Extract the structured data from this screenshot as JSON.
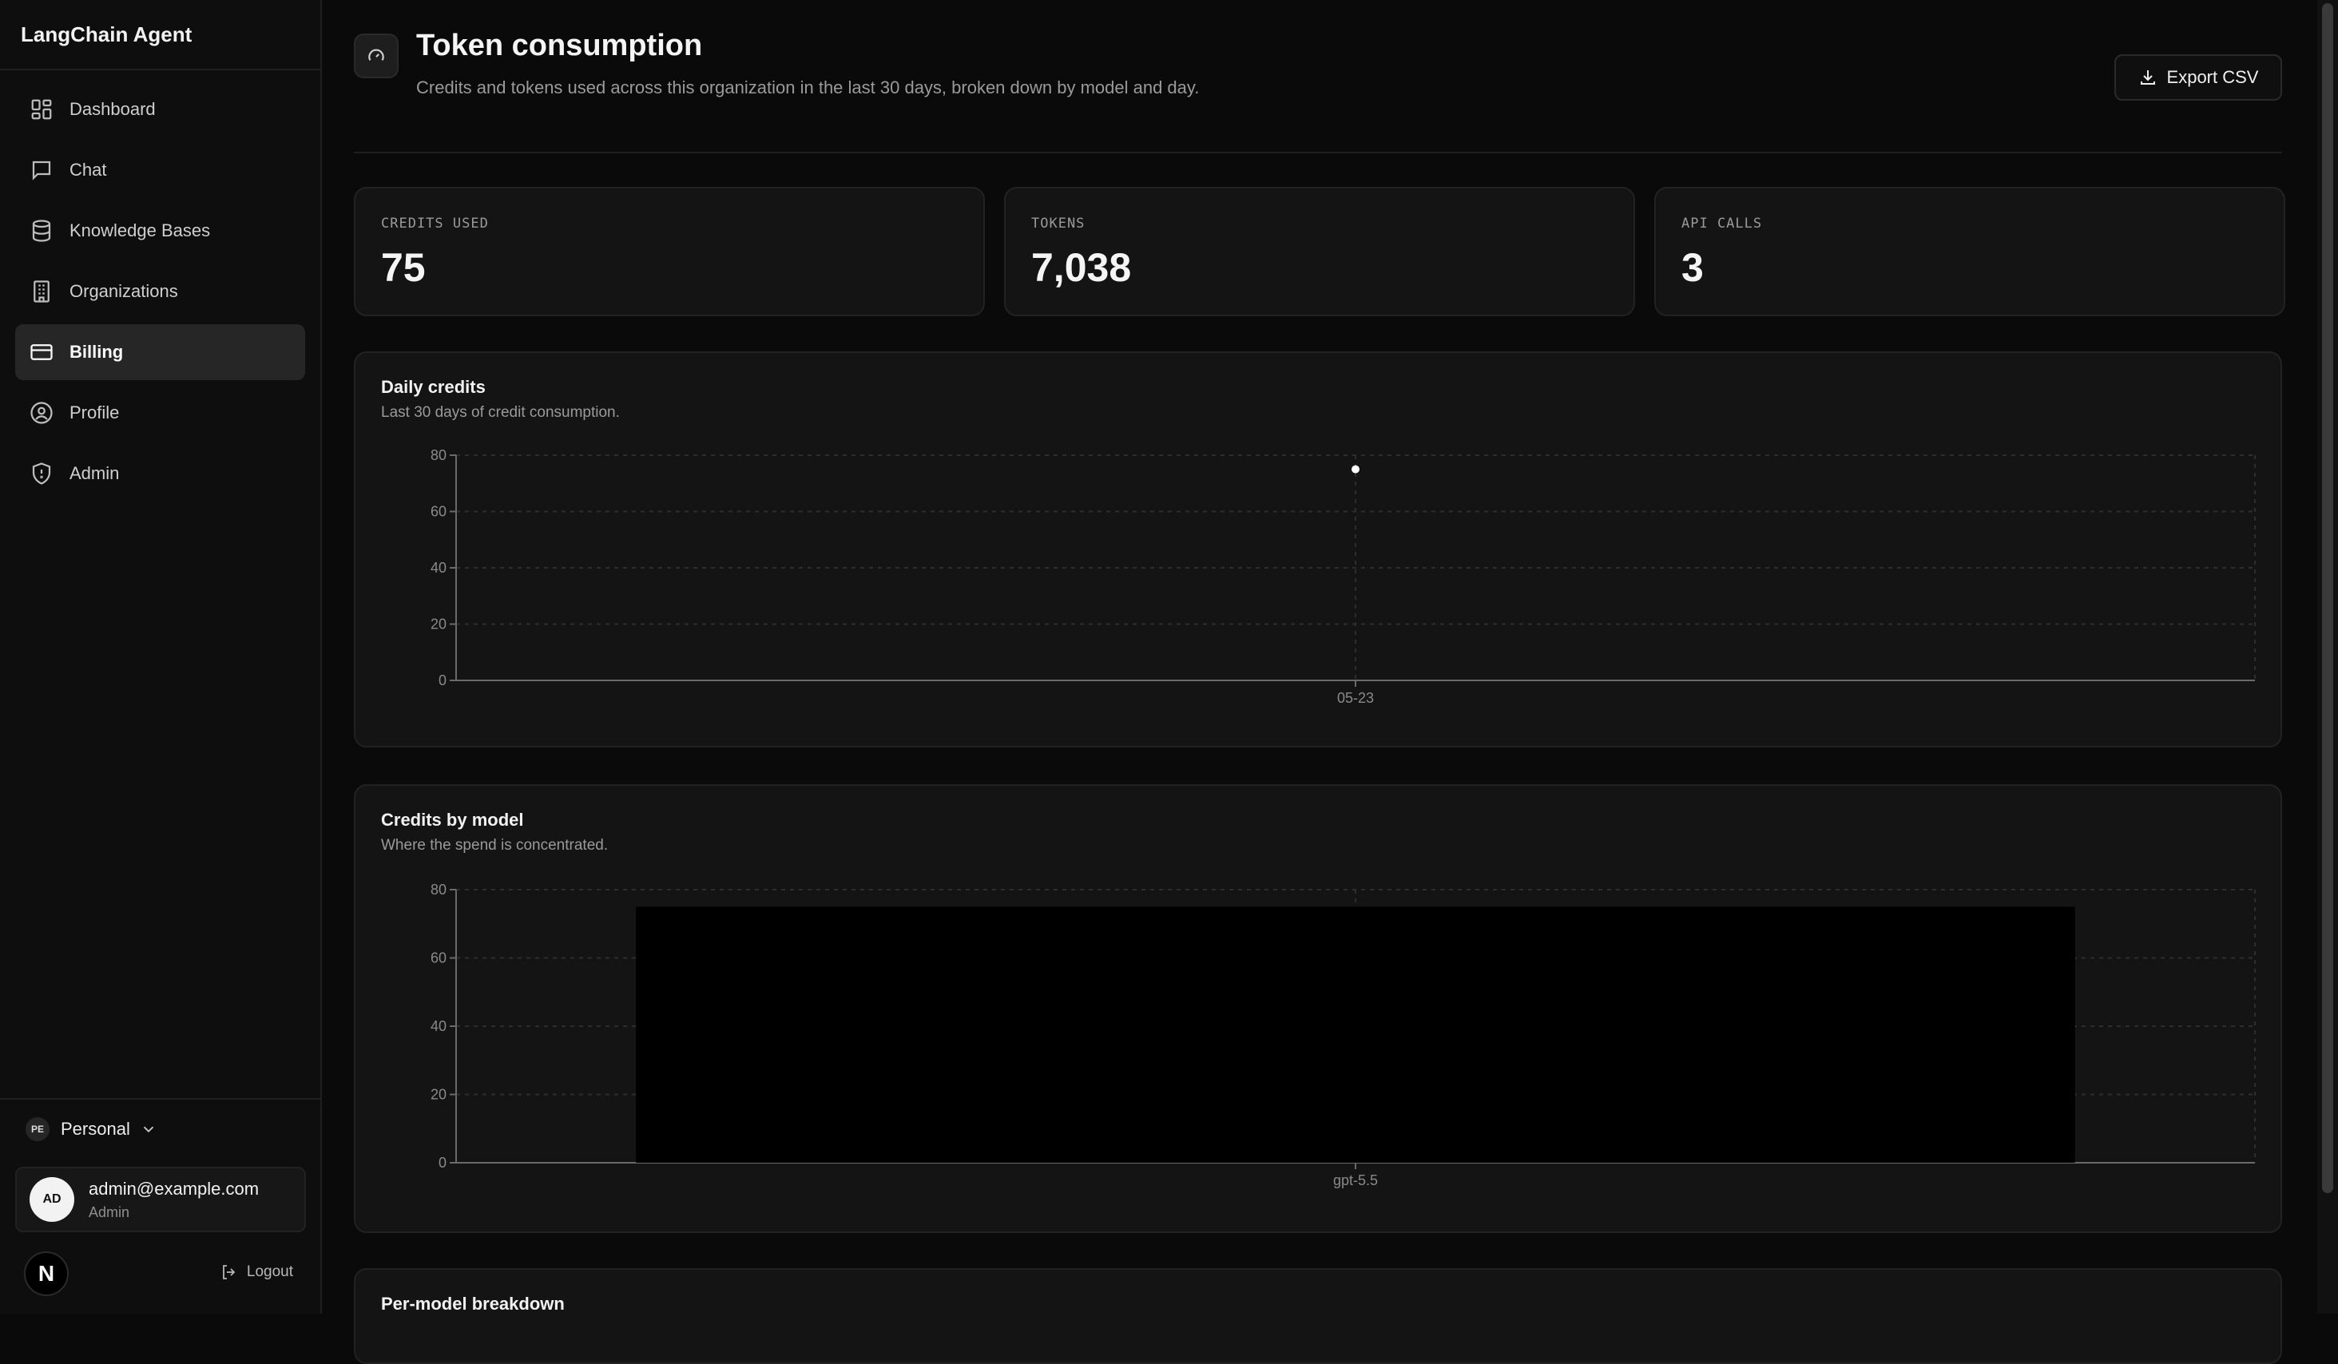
{
  "app": {
    "title": "LangChain Agent"
  },
  "sidebar": {
    "items": [
      {
        "label": "Dashboard",
        "icon": "dashboard-icon"
      },
      {
        "label": "Chat",
        "icon": "chat-icon"
      },
      {
        "label": "Knowledge Bases",
        "icon": "database-icon"
      },
      {
        "label": "Organizations",
        "icon": "building-icon"
      },
      {
        "label": "Billing",
        "icon": "credit-card-icon",
        "active": true
      },
      {
        "label": "Profile",
        "icon": "user-circle-icon"
      },
      {
        "label": "Admin",
        "icon": "shield-icon"
      }
    ],
    "org": {
      "badge": "PE",
      "name": "Personal"
    },
    "user": {
      "initials": "AD",
      "email": "admin@example.com",
      "role": "Admin"
    },
    "logo_letter": "N",
    "logout_label": "Logout"
  },
  "header": {
    "title": "Token consumption",
    "subtitle": "Credits and tokens used across this organization in the last 30 days, broken down by model and day.",
    "export_label": "Export CSV"
  },
  "stats": [
    {
      "label": "CREDITS USED",
      "value": "75"
    },
    {
      "label": "TOKENS",
      "value": "7,038"
    },
    {
      "label": "API CALLS",
      "value": "3"
    }
  ],
  "daily_card": {
    "title": "Daily credits",
    "subtitle": "Last 30 days of credit consumption."
  },
  "model_card": {
    "title": "Credits by model",
    "subtitle": "Where the spend is concentrated."
  },
  "breakdown_card": {
    "title": "Per-model breakdown"
  },
  "colors": {
    "background": "#0a0a0a",
    "card": "#141414",
    "bar": "#000000",
    "point": "#ffffff"
  },
  "chart_data": [
    {
      "type": "scatter",
      "title": "Daily credits",
      "x": [
        "05-23"
      ],
      "y": [
        75
      ],
      "ylim": [
        0,
        80
      ],
      "yticks": [
        0,
        20,
        40,
        60,
        80
      ],
      "grid": true
    },
    {
      "type": "bar",
      "title": "Credits by model",
      "categories": [
        "gpt-5.5"
      ],
      "values": [
        75
      ],
      "ylim": [
        0,
        80
      ],
      "yticks": [
        0,
        20,
        40,
        60,
        80
      ],
      "grid": true
    }
  ]
}
